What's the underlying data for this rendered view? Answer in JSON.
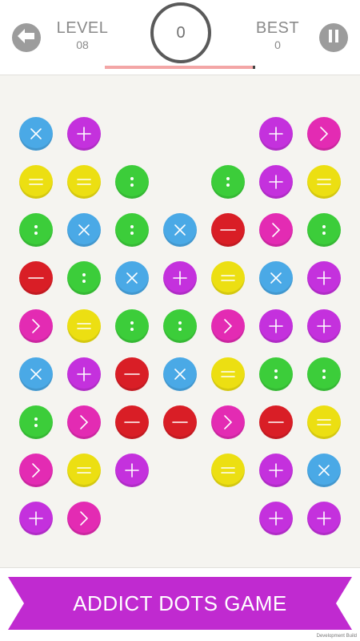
{
  "header": {
    "level_label": "LEVEL",
    "level_value": "08",
    "best_label": "BEST",
    "best_value": "0",
    "score": "0",
    "progress_fraction": 1.0
  },
  "footer": {
    "banner_text": "ADDICT DOTS GAME",
    "dev_note": "Development Build"
  },
  "colors": {
    "blue": "#4aa9e6",
    "purple": "#c431dd",
    "yellow": "#ecdf12",
    "green": "#3ccd3a",
    "red": "#d91e26",
    "magenta": "#e32bb3",
    "banner": "#c02ad0",
    "button_gray": "#9c9c9c"
  },
  "board": {
    "rows": 9,
    "cols": 7,
    "grid": [
      [
        "blue-x",
        "purple-plus",
        null,
        null,
        null,
        "purple-plus",
        "magenta-gt"
      ],
      [
        "yellow-eq",
        "yellow-eq",
        "green-colon",
        null,
        "green-colon",
        "purple-plus",
        "yellow-eq"
      ],
      [
        "green-colon",
        "blue-x",
        "green-colon",
        "blue-x",
        "red-minus",
        "magenta-gt",
        "green-colon"
      ],
      [
        "red-minus",
        "green-colon",
        "blue-x",
        "purple-plus",
        "yellow-eq",
        "blue-x",
        "purple-plus"
      ],
      [
        "magenta-gt",
        "yellow-eq",
        "green-colon",
        "green-colon",
        "magenta-gt",
        "purple-plus",
        "purple-plus"
      ],
      [
        "blue-x",
        "purple-plus",
        "red-minus",
        "blue-x",
        "yellow-eq",
        "green-colon",
        "green-colon"
      ],
      [
        "green-colon",
        "magenta-gt",
        "red-minus",
        "red-minus",
        "magenta-gt",
        "red-minus",
        "yellow-eq"
      ],
      [
        "magenta-gt",
        "yellow-eq",
        "purple-plus",
        null,
        "yellow-eq",
        "purple-plus",
        "blue-x"
      ],
      [
        "purple-plus",
        "magenta-gt",
        null,
        null,
        null,
        "purple-plus",
        "purple-plus"
      ]
    ]
  }
}
